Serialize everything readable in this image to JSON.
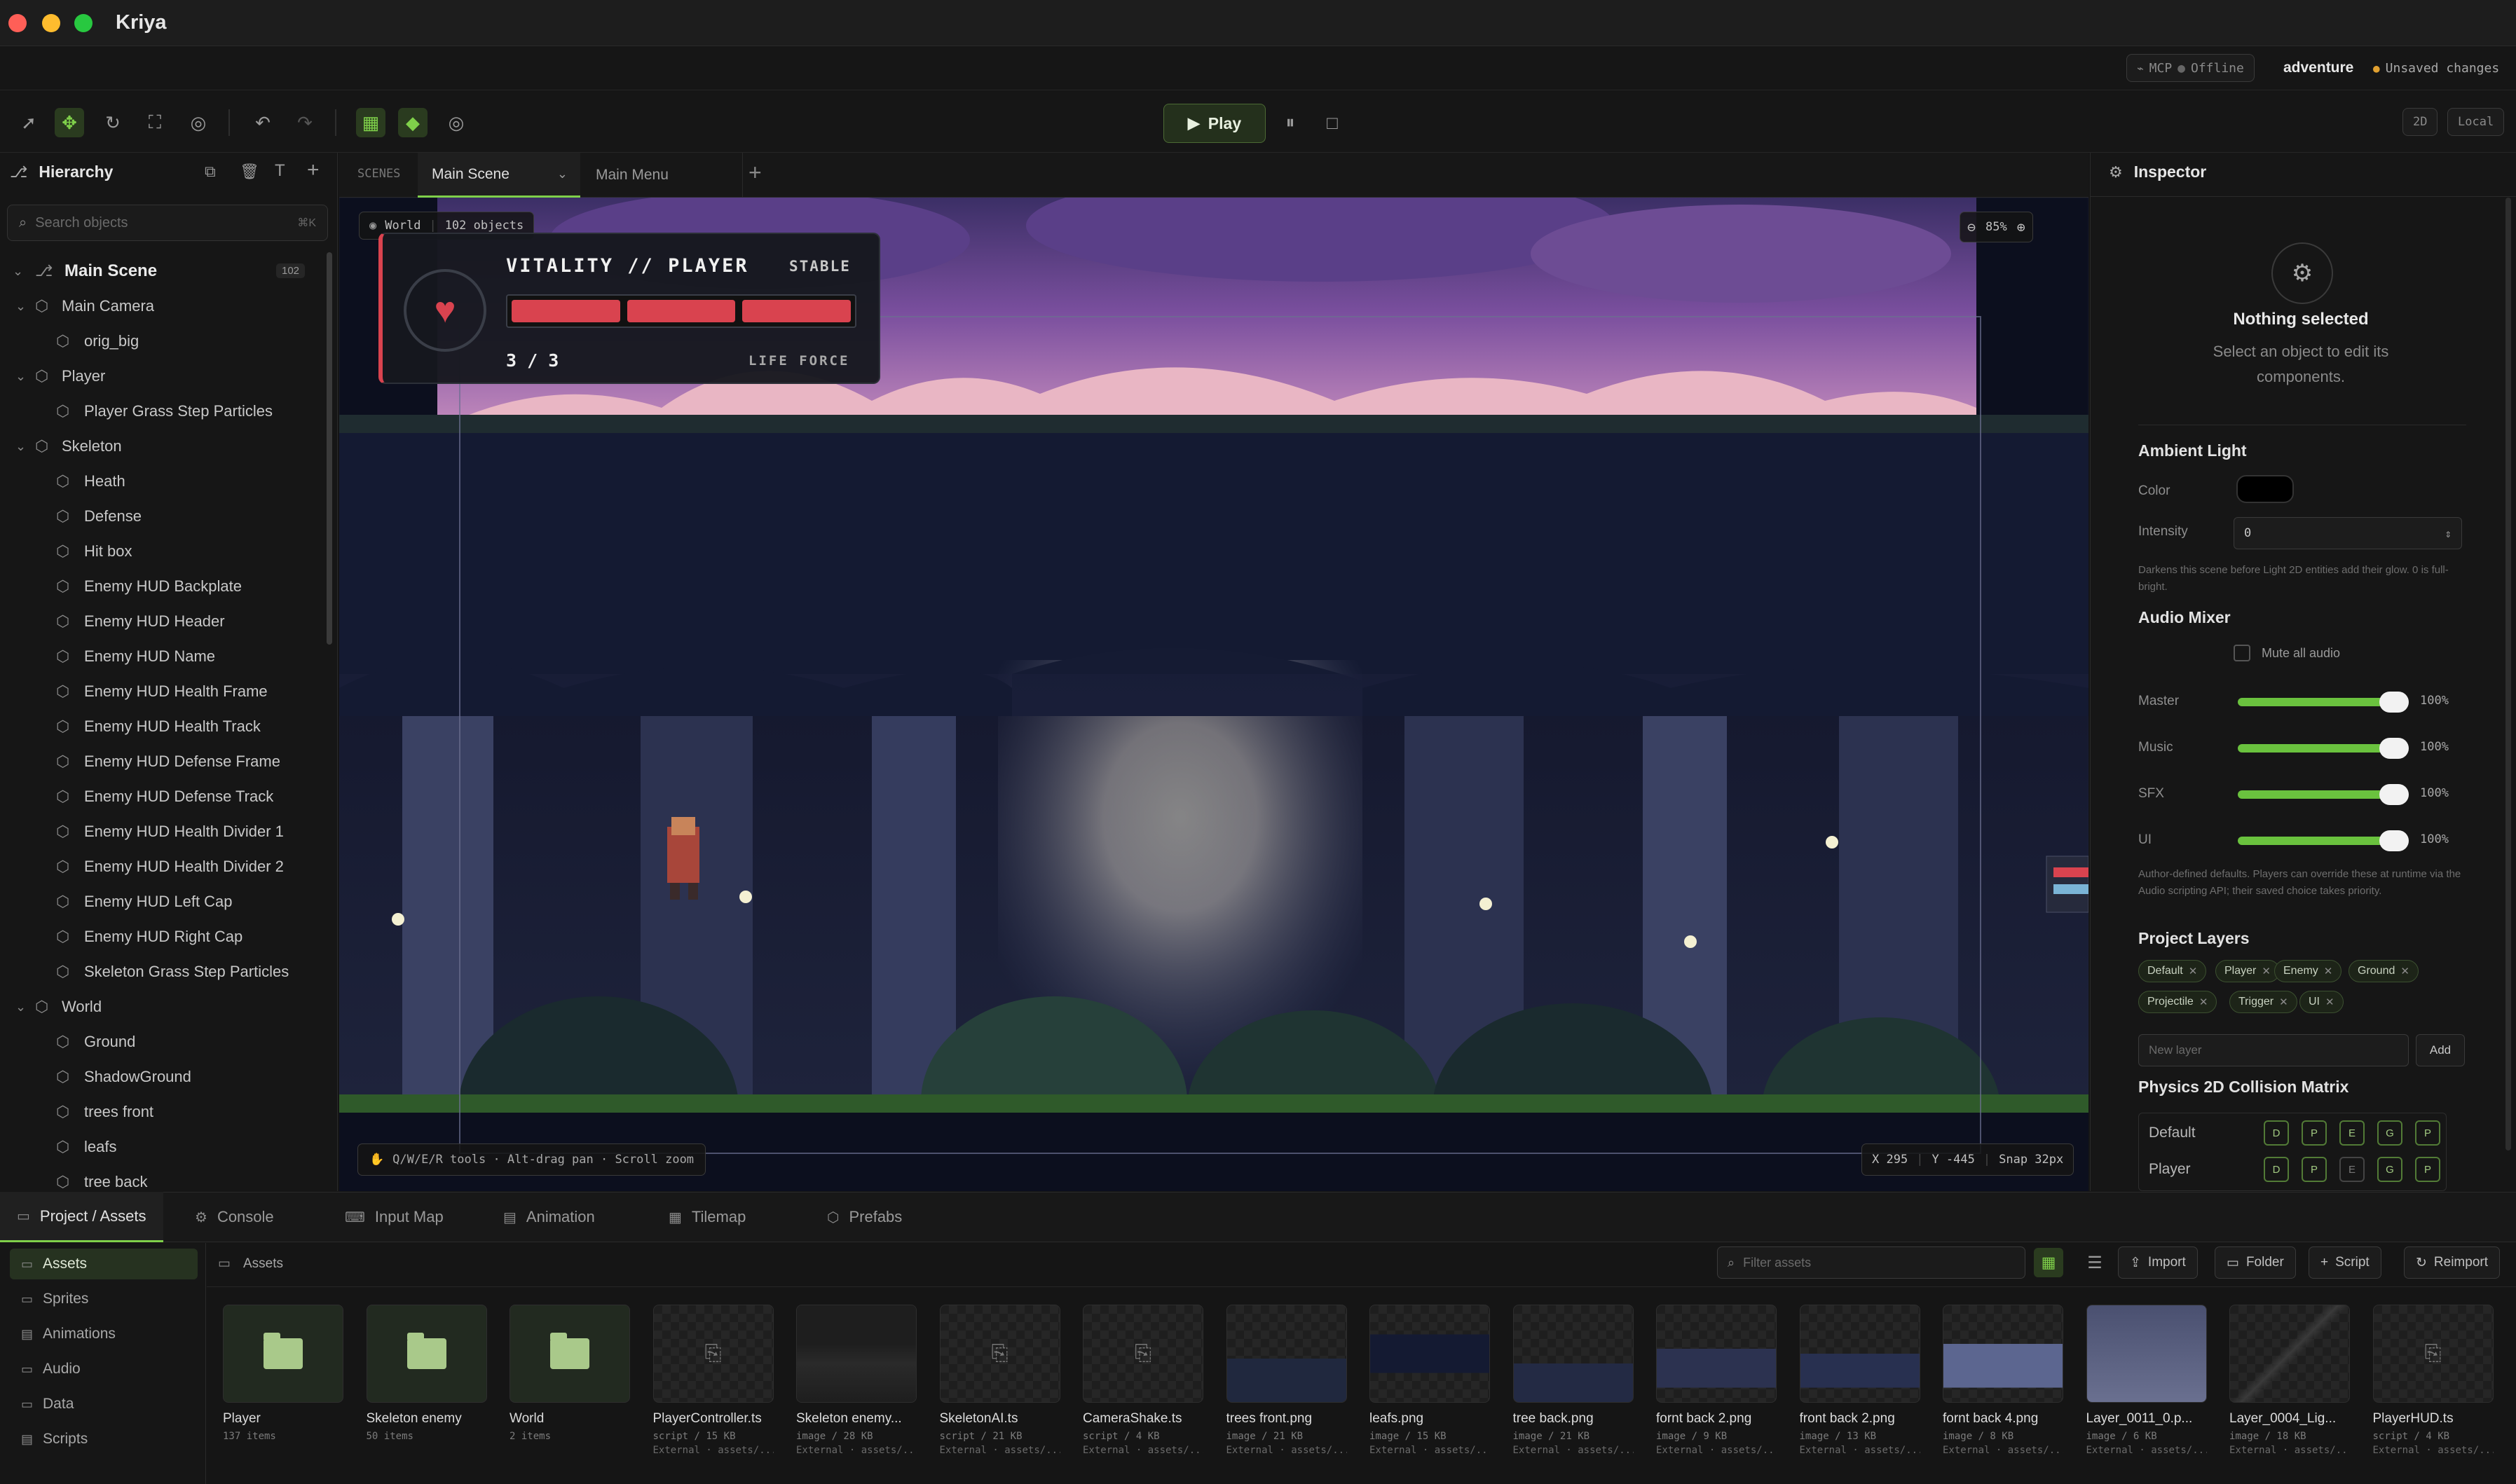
{
  "window": {
    "title": "Kriya"
  },
  "status": {
    "mcp_label": "MCP",
    "mcp_state": "Offline",
    "project_name": "adventure",
    "unsaved": "Unsaved changes",
    "mode_2d": "2D",
    "space": "Local"
  },
  "toolbar": {
    "play_label": "Play"
  },
  "hierarchy": {
    "title": "Hierarchy",
    "search_placeholder": "Search objects",
    "search_shortcut": "⌘K",
    "root": {
      "label": "Main Scene",
      "count": "102"
    },
    "items": [
      {
        "label": "Main Camera",
        "depth": 1,
        "expandable": true
      },
      {
        "label": "orig_big",
        "depth": 2,
        "expandable": false
      },
      {
        "label": "Player",
        "depth": 1,
        "expandable": true
      },
      {
        "label": "Player Grass Step Particles",
        "depth": 2,
        "expandable": false
      },
      {
        "label": "Skeleton",
        "depth": 1,
        "expandable": true
      },
      {
        "label": "Heath",
        "depth": 2,
        "expandable": false
      },
      {
        "label": "Defense",
        "depth": 2,
        "expandable": false
      },
      {
        "label": "Hit box",
        "depth": 2,
        "expandable": false
      },
      {
        "label": "Enemy HUD Backplate",
        "depth": 2,
        "expandable": false
      },
      {
        "label": "Enemy HUD Header",
        "depth": 2,
        "expandable": false
      },
      {
        "label": "Enemy HUD Name",
        "depth": 2,
        "expandable": false
      },
      {
        "label": "Enemy HUD Health Frame",
        "depth": 2,
        "expandable": false
      },
      {
        "label": "Enemy HUD Health Track",
        "depth": 2,
        "expandable": false
      },
      {
        "label": "Enemy HUD Defense Frame",
        "depth": 2,
        "expandable": false
      },
      {
        "label": "Enemy HUD Defense Track",
        "depth": 2,
        "expandable": false
      },
      {
        "label": "Enemy HUD Health Divider 1",
        "depth": 2,
        "expandable": false
      },
      {
        "label": "Enemy HUD Health Divider 2",
        "depth": 2,
        "expandable": false
      },
      {
        "label": "Enemy HUD Left Cap",
        "depth": 2,
        "expandable": false
      },
      {
        "label": "Enemy HUD Right Cap",
        "depth": 2,
        "expandable": false
      },
      {
        "label": "Skeleton Grass Step Particles",
        "depth": 2,
        "expandable": false
      },
      {
        "label": "World",
        "depth": 1,
        "expandable": true
      },
      {
        "label": "Ground",
        "depth": 2,
        "expandable": false
      },
      {
        "label": "ShadowGround",
        "depth": 2,
        "expandable": false
      },
      {
        "label": "trees front",
        "depth": 2,
        "expandable": false
      },
      {
        "label": "leafs",
        "depth": 2,
        "expandable": false
      },
      {
        "label": "tree back",
        "depth": 2,
        "expandable": false
      }
    ]
  },
  "scenes": {
    "label": "SCENES",
    "tabs": [
      {
        "label": "Main Scene"
      },
      {
        "label": "Main Menu"
      }
    ]
  },
  "viewport": {
    "world_label": "World",
    "object_count": "102 objects",
    "zoom": "85%",
    "hint": "Q/W/E/R tools · Alt-drag pan · Scroll zoom",
    "coord_x": "X 295",
    "coord_y": "Y -445",
    "snap": "Snap 32px",
    "hud": {
      "title": "VITALITY // PLAYER",
      "status": "STABLE",
      "value": "3 / 3",
      "caption": "LIFE FORCE",
      "segments_filled": 3,
      "segments_total": 3
    }
  },
  "inspector": {
    "title": "Inspector",
    "empty_title": "Nothing selected",
    "empty_sub": "Select an object to edit its components.",
    "ambient": {
      "title": "Ambient Light",
      "color_label": "Color",
      "color_value": "#000000",
      "intensity_label": "Intensity",
      "intensity_value": "0",
      "note": "Darkens this scene before Light 2D entities add their glow. 0 is full-bright."
    },
    "audio": {
      "title": "Audio Mixer",
      "mute_label": "Mute all audio",
      "channels": [
        {
          "label": "Master",
          "pct": "100%",
          "value": 1.0
        },
        {
          "label": "Music",
          "pct": "100%",
          "value": 1.0
        },
        {
          "label": "SFX",
          "pct": "100%",
          "value": 1.0
        },
        {
          "label": "UI",
          "pct": "100%",
          "value": 1.0
        }
      ],
      "note": "Author-defined defaults. Players can override these at runtime via the Audio scripting API; their saved choice takes priority."
    },
    "layers": {
      "title": "Project Layers",
      "chips": [
        "Default",
        "Player",
        "Enemy",
        "Ground",
        "Projectile",
        "Trigger",
        "UI"
      ],
      "new_placeholder": "New layer",
      "add_label": "Add"
    },
    "physics": {
      "title": "Physics 2D Collision Matrix",
      "rows": [
        {
          "label": "Default",
          "cells": [
            "D",
            "P",
            "E",
            "G",
            "P"
          ],
          "active": [
            true,
            true,
            true,
            true,
            true
          ]
        },
        {
          "label": "Player",
          "cells": [
            "D",
            "P",
            "E",
            "G",
            "P"
          ],
          "active": [
            true,
            true,
            false,
            true,
            true
          ]
        }
      ]
    }
  },
  "bottom": {
    "tabs": [
      {
        "label": "Project / Assets",
        "icon": "folder-icon"
      },
      {
        "label": "Console",
        "icon": "gear-icon"
      },
      {
        "label": "Input Map",
        "icon": "keyboard-icon"
      },
      {
        "label": "Animation",
        "icon": "film-icon"
      },
      {
        "label": "Tilemap",
        "icon": "grid-icon"
      },
      {
        "label": "Prefabs",
        "icon": "cube-icon"
      }
    ],
    "sidebar": [
      "Assets",
      "Sprites",
      "Animations",
      "Audio",
      "Data",
      "Scripts"
    ],
    "breadcrumb": "Assets",
    "filter_placeholder": "Filter assets",
    "buttons": {
      "import": "Import",
      "folder": "Folder",
      "script": "Script",
      "reimport": "Reimport"
    },
    "assets": [
      {
        "name": "Player",
        "meta": "137 items",
        "meta2": "",
        "kind": "folder"
      },
      {
        "name": "Skeleton enemy",
        "meta": "50 items",
        "meta2": "",
        "kind": "folder"
      },
      {
        "name": "World",
        "meta": "2 items",
        "meta2": "",
        "kind": "folder"
      },
      {
        "name": "PlayerController.ts",
        "meta": "script / 15 KB",
        "meta2": "External · assets/...",
        "kind": "script"
      },
      {
        "name": "Skeleton enemy...",
        "meta": "image / 28 KB",
        "meta2": "External · assets/...",
        "kind": "image"
      },
      {
        "name": "SkeletonAI.ts",
        "meta": "script / 21 KB",
        "meta2": "External · assets/...",
        "kind": "script"
      },
      {
        "name": "CameraShake.ts",
        "meta": "script / 4 KB",
        "meta2": "External · assets/...",
        "kind": "script"
      },
      {
        "name": "trees front.png",
        "meta": "image / 21 KB",
        "meta2": "External · assets/...",
        "kind": "image"
      },
      {
        "name": "leafs.png",
        "meta": "image / 15 KB",
        "meta2": "External · assets/...",
        "kind": "image"
      },
      {
        "name": "tree back.png",
        "meta": "image / 21 KB",
        "meta2": "External · assets/...",
        "kind": "image"
      },
      {
        "name": "fornt back 2.png",
        "meta": "image / 9 KB",
        "meta2": "External · assets/...",
        "kind": "image"
      },
      {
        "name": "front back 2.png",
        "meta": "image / 13 KB",
        "meta2": "External · assets/...",
        "kind": "image"
      },
      {
        "name": "fornt back 4.png",
        "meta": "image / 8 KB",
        "meta2": "External · assets/...",
        "kind": "image"
      },
      {
        "name": "Layer_0011_0.p...",
        "meta": "image / 6 KB",
        "meta2": "External · assets/...",
        "kind": "image"
      },
      {
        "name": "Layer_0004_Lig...",
        "meta": "image / 18 KB",
        "meta2": "External · assets/...",
        "kind": "image"
      },
      {
        "name": "PlayerHUD.ts",
        "meta": "script / 4 KB",
        "meta2": "External · assets/...",
        "kind": "script"
      }
    ]
  },
  "colors": {
    "accent": "#7fd04a",
    "warning": "#e0a030",
    "hud_red": "#d9434f"
  }
}
